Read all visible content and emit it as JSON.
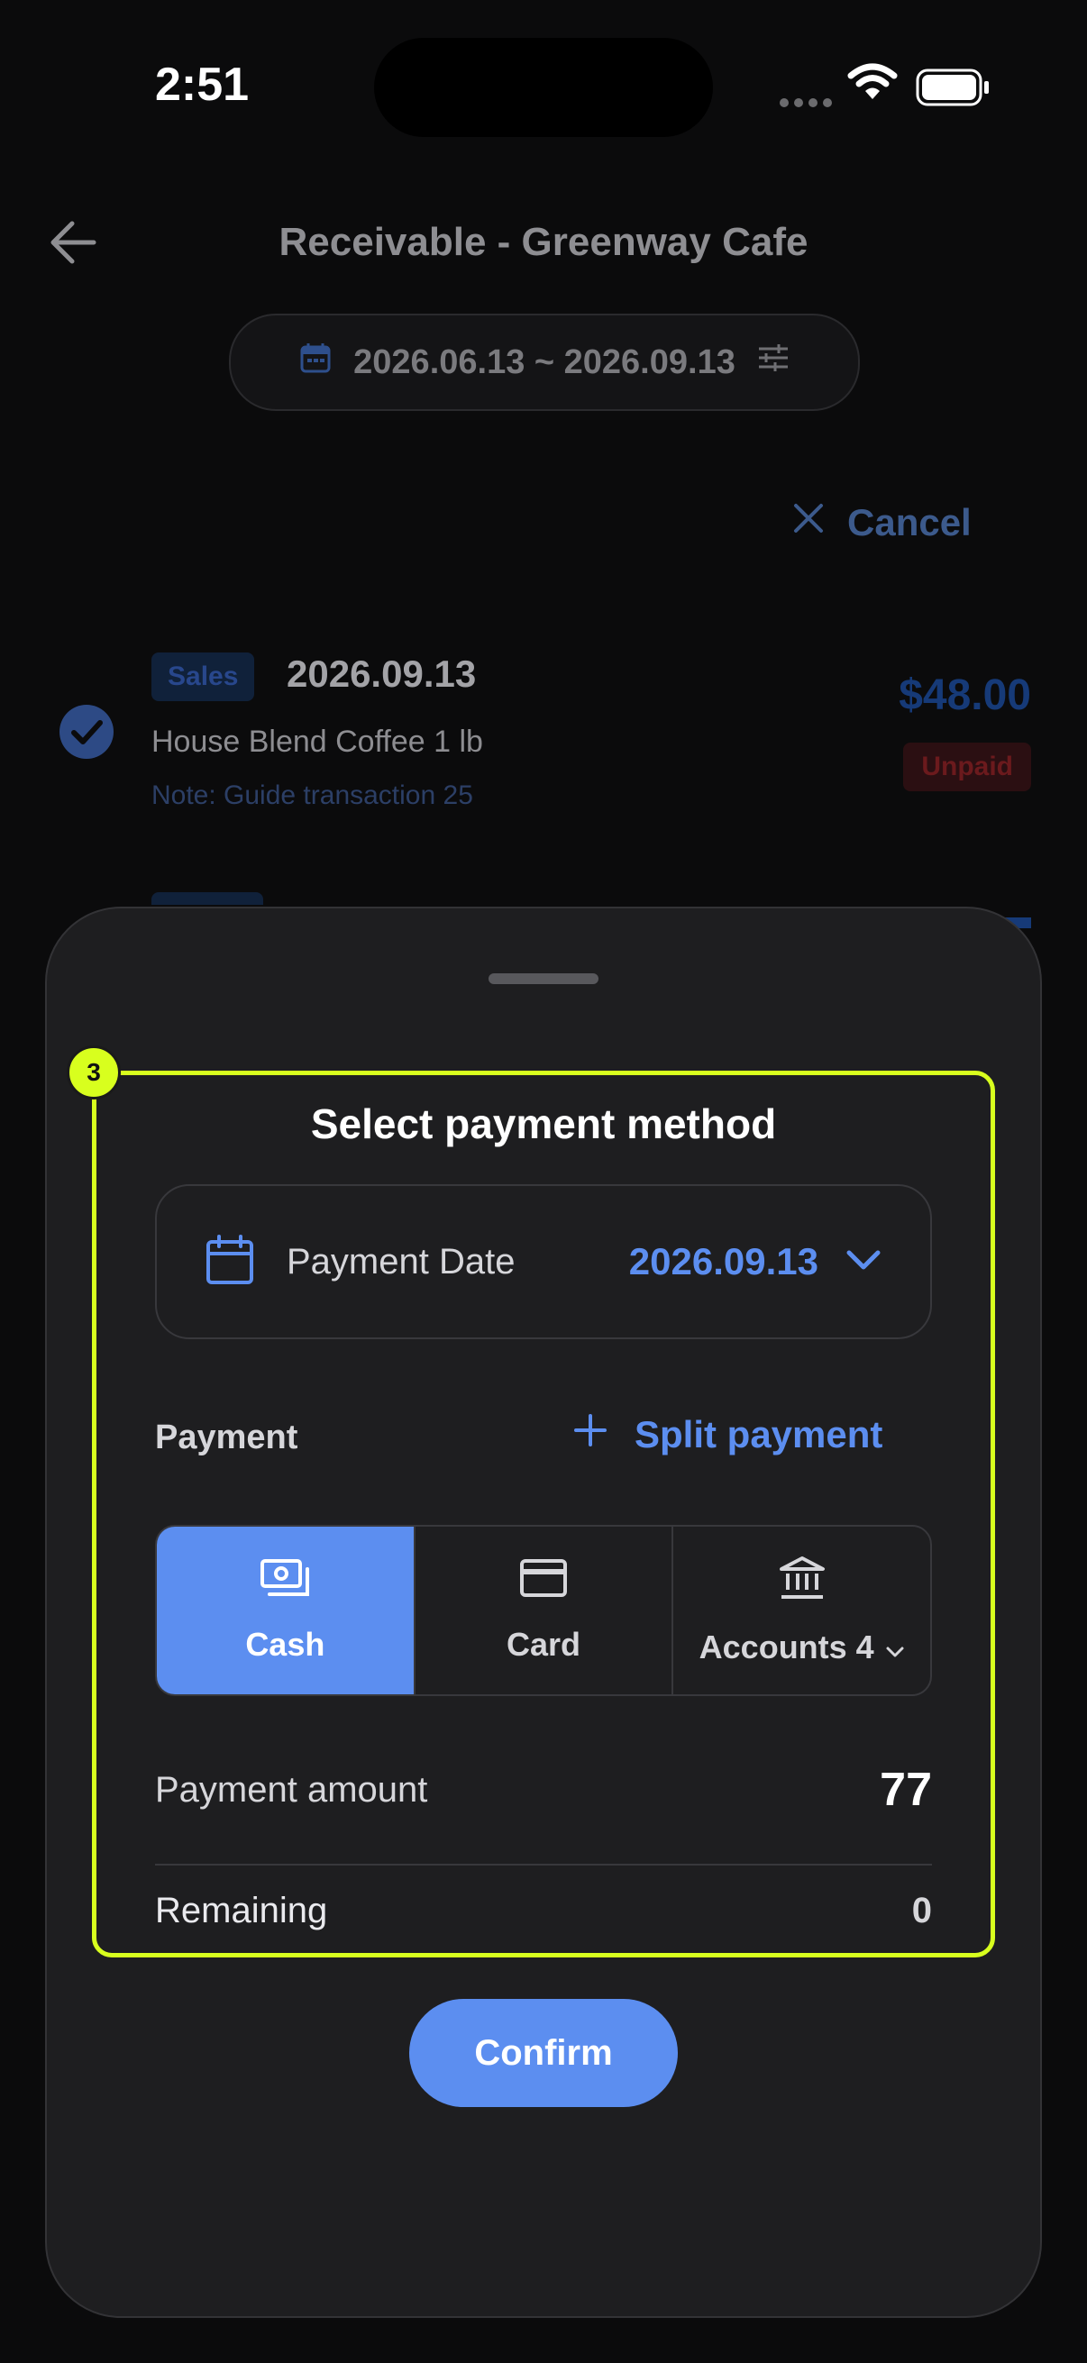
{
  "status_bar": {
    "time": "2:51"
  },
  "header": {
    "title": "Receivable - Greenway Cafe",
    "date_range": "2026.06.13 ~ 2026.09.13",
    "cancel_label": "Cancel"
  },
  "transaction": {
    "type_badge": "Sales",
    "date": "2026.09.13",
    "item": "House Blend Coffee 1 lb",
    "note": "Note: Guide transaction 25",
    "amount": "$48.00",
    "status": "Unpaid"
  },
  "sheet": {
    "step_number": "3",
    "title": "Select payment method",
    "payment_date_label": "Payment Date",
    "payment_date_value": "2026.09.13",
    "payment_label": "Payment",
    "split_payment_label": "Split payment",
    "methods": [
      {
        "label": "Cash",
        "selected": true,
        "icon": "cash-icon"
      },
      {
        "label": "Card",
        "selected": false,
        "icon": "card-icon"
      },
      {
        "label": "Accounts 4",
        "selected": false,
        "icon": "bank-icon"
      }
    ],
    "payment_amount_label": "Payment amount",
    "payment_amount_value": "77",
    "remaining_label": "Remaining",
    "remaining_value": "0",
    "confirm_label": "Confirm"
  },
  "colors": {
    "accent": "#5c8ef0",
    "highlight": "#d8ff1e",
    "sheet_bg": "#1e1e20",
    "page_bg": "#0b0b0c"
  }
}
